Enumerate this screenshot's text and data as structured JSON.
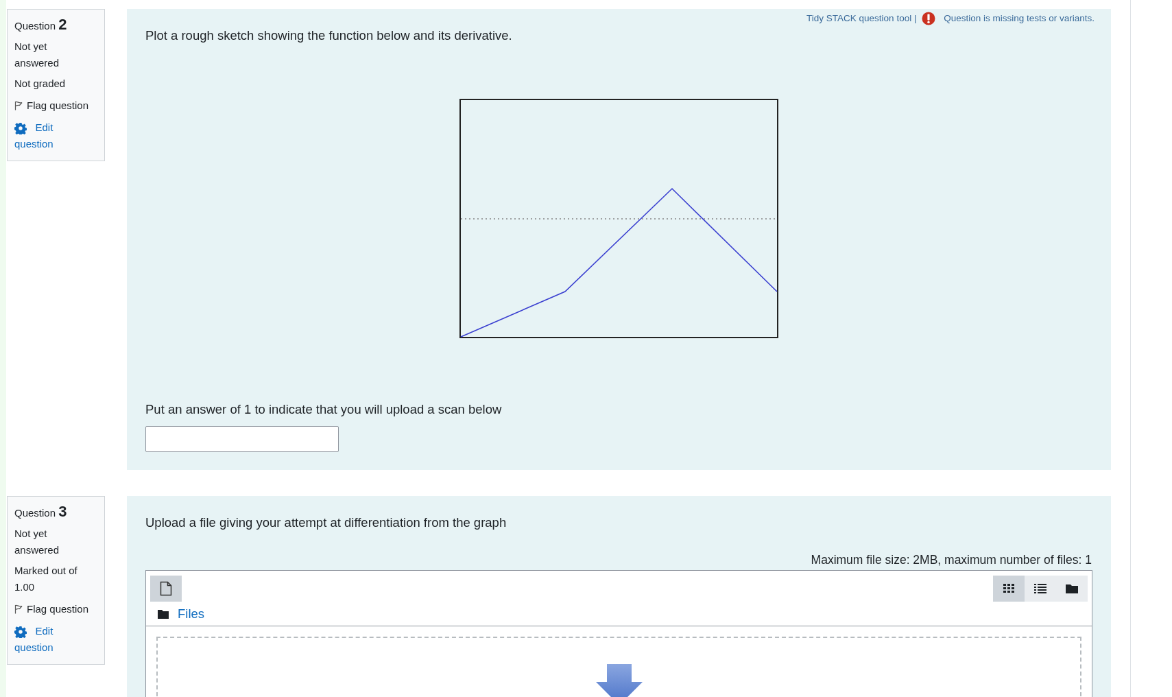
{
  "questions": [
    {
      "kind": "stack",
      "label": "Question",
      "number": "2",
      "status": "Not yet answered",
      "grade": "Not graded",
      "flag": {
        "label": "Flag question",
        "flagged": false
      },
      "edit": "Edit question",
      "tools": {
        "tidy": "Tidy STACK question tool |",
        "warning": "Question is missing tests or variants."
      },
      "prompt": "Plot a rough sketch showing the function below and its derivative.",
      "answer_prompt": "Put an answer of 1 to indicate that you will upload a scan below"
    },
    {
      "kind": "upload",
      "label": "Question",
      "number": "3",
      "status": "Not yet answered",
      "grade": "Marked out of 1.00",
      "flag": {
        "label": "Flag question",
        "flagged": false
      },
      "edit": "Edit question",
      "prompt": "Upload a file giving your attempt at differentiation from the graph",
      "limits": "Maximum file size: 2MB, maximum number of files: 1",
      "path": "Files",
      "views": [
        {
          "kind": "grid",
          "selected": true
        },
        {
          "kind": "list",
          "selected": false
        },
        {
          "kind": "folder",
          "selected": false
        }
      ]
    }
  ]
}
